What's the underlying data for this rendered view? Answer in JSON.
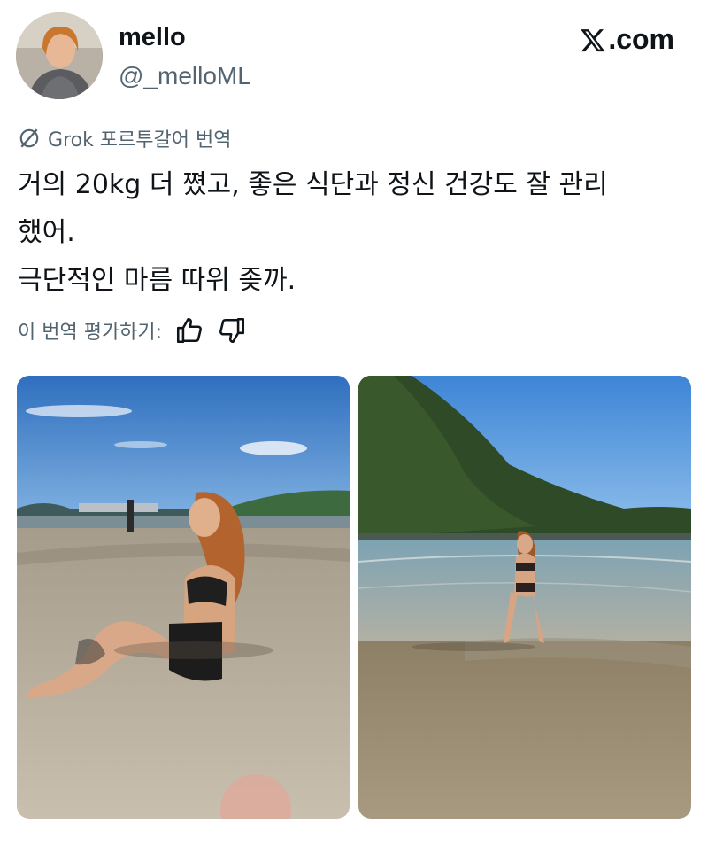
{
  "author": {
    "display_name": "mello",
    "handle": "@_melloML"
  },
  "brand": {
    "site": ".com"
  },
  "translation": {
    "label": "Grok 포르투갈어 번역"
  },
  "tweet": {
    "lines": [
      "거의 20kg 더 쪘고, 좋은 식단과 정신 건강도 잘 관리",
      "했어.",
      "극단적인 마름 따위 좆까."
    ]
  },
  "rating": {
    "label": "이 번역 평가하기:",
    "like_icon": "thumbs-up-icon",
    "dislike_icon": "thumbs-down-icon"
  },
  "media": {
    "count": 2
  },
  "colors": {
    "text": "#0f1419",
    "secondary": "#536471",
    "background": "#ffffff"
  }
}
